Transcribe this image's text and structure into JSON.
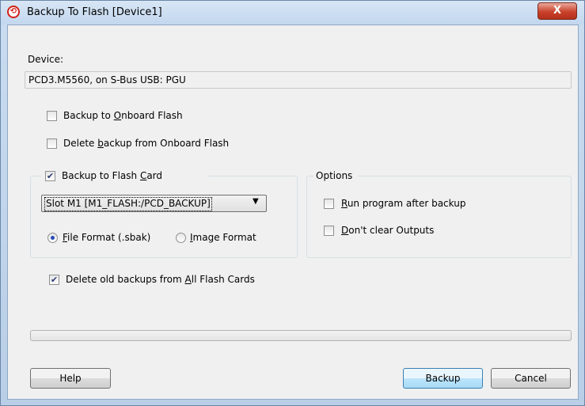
{
  "window": {
    "title": "Backup To Flash [Device1]",
    "close_label": "X",
    "app_icon": "saia-circle-icon"
  },
  "device": {
    "label": "Device:",
    "value": "PCD3.M5560, on S-Bus USB: PGU"
  },
  "onboard": {
    "backup_label_pre": "Backup to ",
    "backup_label_accel": "O",
    "backup_label_post": "nboard Flash",
    "backup_checked": false,
    "delete_label_pre": "Delete ",
    "delete_label_accel": "b",
    "delete_label_post": "ackup from Onboard Flash",
    "delete_checked": false
  },
  "flash_card": {
    "label_pre": "Backup to Flash ",
    "label_accel": "C",
    "label_post": "ard",
    "checked": true,
    "slot_selected": "Slot M1 [M1_FLASH:/PCD_BACKUP]",
    "format_file_accel": "F",
    "format_file_post": "ile Format (.sbak)",
    "format_file_selected": true,
    "format_image_accel": "I",
    "format_image_post": "mage Format",
    "format_image_selected": false
  },
  "options": {
    "title": "Options",
    "run_accel": "R",
    "run_post": "un program after backup",
    "run_checked": false,
    "dont_accel": "D",
    "dont_post": "on't clear Outputs",
    "dont_checked": false
  },
  "delete_old": {
    "label_pre": "Delete old backups from ",
    "label_accel": "A",
    "label_post": "ll Flash Cards",
    "checked": true
  },
  "progress": {
    "value": 0
  },
  "buttons": {
    "help": "Help",
    "backup": "Backup",
    "cancel": "Cancel"
  },
  "colors": {
    "close_red": "#c9412a",
    "check_mark": "#2c3c71",
    "radio_dot": "#2a4cb7"
  }
}
